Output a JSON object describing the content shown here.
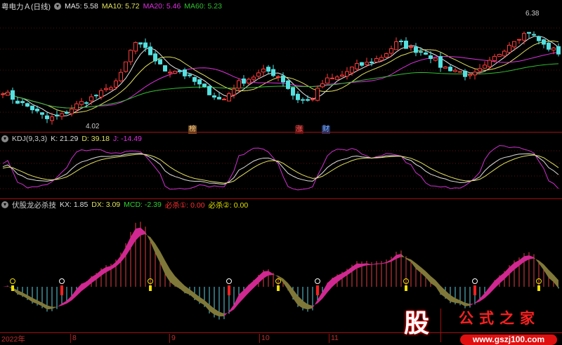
{
  "header": {
    "title": "粤电力Ａ(日线)",
    "ma5": "MA5: 5.58",
    "ma10": "MA10: 5.72",
    "ma20": "MA20: 5.46",
    "ma60": "MA60: 5.23"
  },
  "price": {
    "high_label": "6.38",
    "low_label": "4.02",
    "path": [
      4.73,
      4.51,
      4.36,
      4.14,
      4.21,
      4.43,
      4.58,
      4.73,
      5.02,
      5.76,
      5.54,
      5.17,
      5.17,
      4.95,
      4.73,
      4.51,
      4.88,
      5.02,
      5.17,
      5.02,
      4.58,
      4.51,
      4.95,
      5.02,
      5.24,
      5.32,
      5.47,
      5.76,
      5.61,
      5.54,
      5.24,
      5.17,
      5.02,
      5.24,
      5.54,
      5.83,
      5.98,
      5.69,
      5.54
    ]
  },
  "tags": [
    {
      "text": "榜"
    },
    {
      "text": "涨"
    },
    {
      "text": "财"
    }
  ],
  "kdj": {
    "label": "KDJ(9,3,3)",
    "k": "K: 21.29",
    "d": "D: 39.18",
    "j": "J: -14.49"
  },
  "indicator": {
    "label": "伏股龙必杀技",
    "kx": "KX: 1.85",
    "dx": "DX: 3.09",
    "mcd": "MCD: -2.39",
    "bs1": "必杀①: 0.00",
    "bs2": "必杀②: 0.00"
  },
  "axis": [
    "2022年",
    "8",
    "9",
    "10",
    "11"
  ],
  "logo": {
    "glyph": "股",
    "name": "公式之家",
    "url": "www.gszj100.com"
  },
  "colors": {
    "up": "#ff3a3a",
    "down": "#54e0e0",
    "ma5": "#e8e8e8",
    "ma10": "#e0e060",
    "ma20": "#e030e0",
    "ma60": "#30c030"
  }
}
